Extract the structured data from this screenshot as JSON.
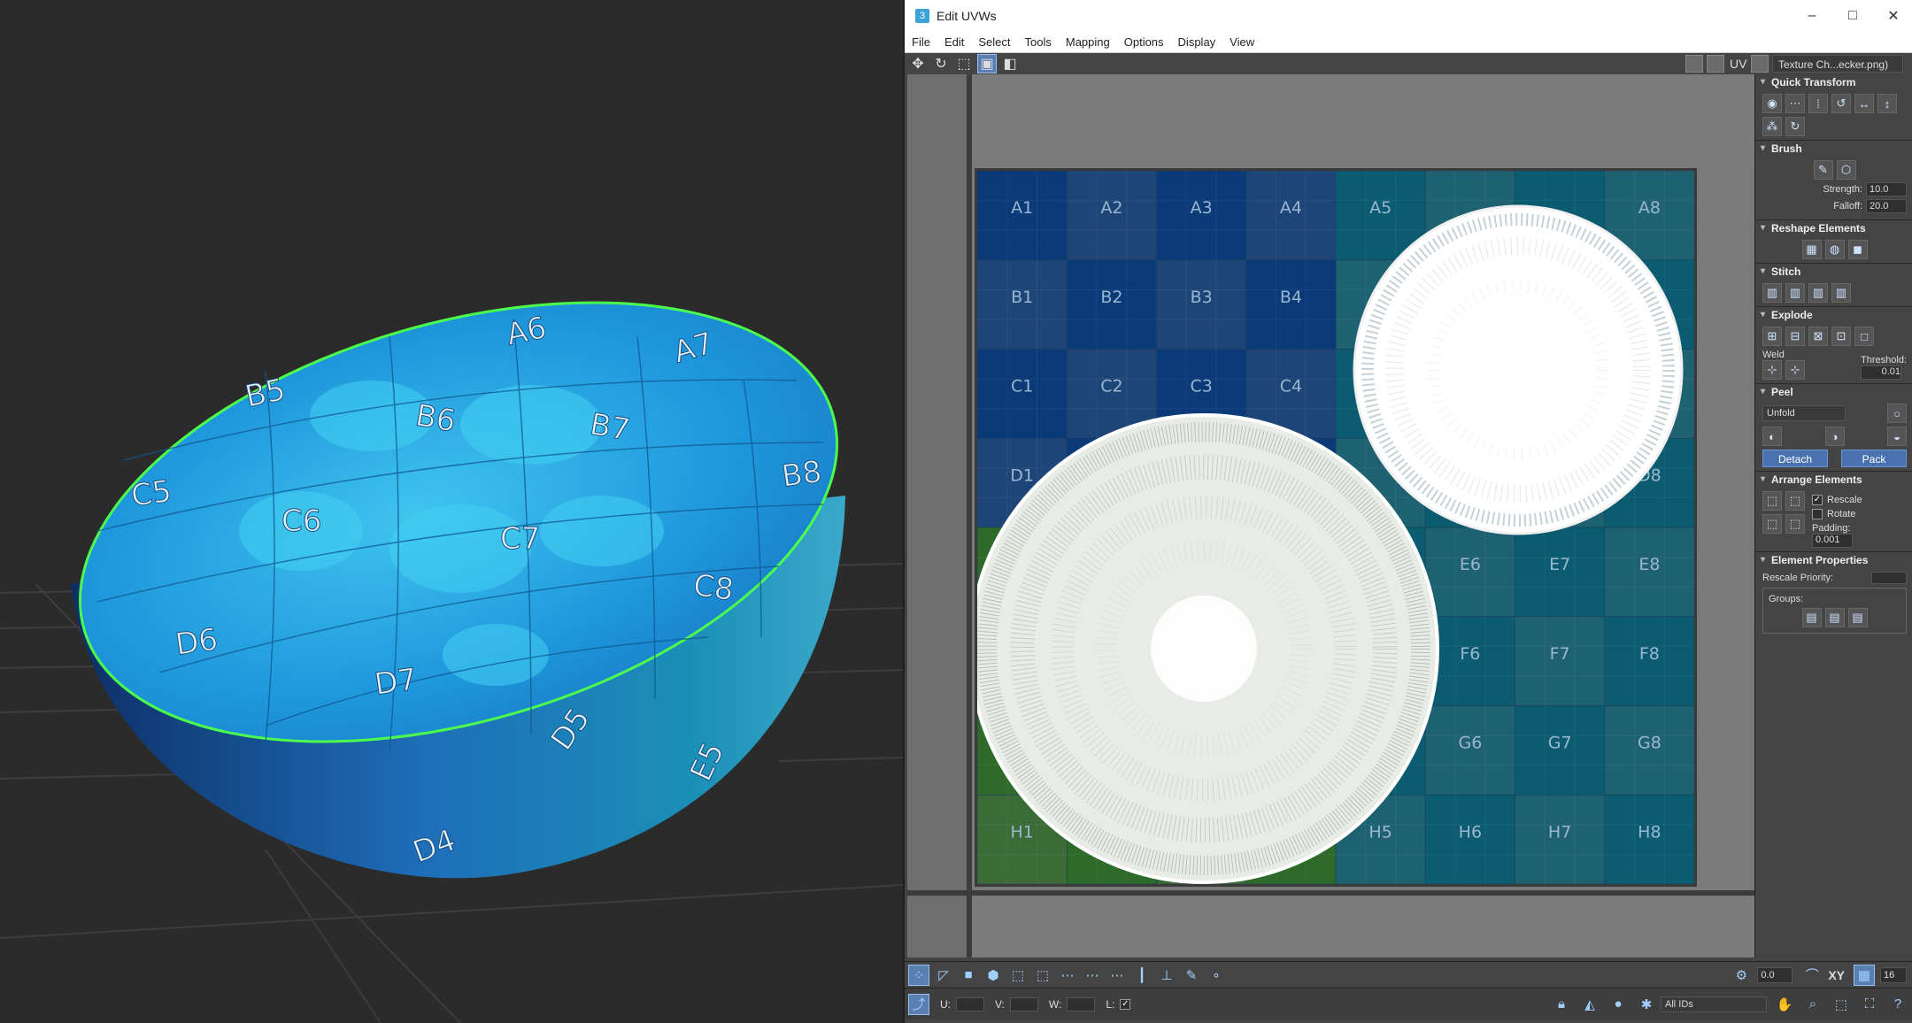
{
  "viewport": {
    "labels": [
      "A6",
      "A7",
      "B5",
      "B6",
      "B7",
      "B8",
      "C5",
      "C6",
      "C7",
      "C8",
      "D6",
      "D7",
      "D5",
      "E5",
      "D4"
    ]
  },
  "window": {
    "title": "Edit UVWs",
    "controls": [
      "–",
      "□",
      "✕"
    ]
  },
  "menu": [
    "File",
    "Edit",
    "Select",
    "Tools",
    "Mapping",
    "Options",
    "Display",
    "View"
  ],
  "toolbar": {
    "uv_label": "UV",
    "texture": "Texture Ch...ecker.png)"
  },
  "checker": {
    "rows": [
      "A",
      "B",
      "C",
      "D",
      "E",
      "F",
      "G",
      "H"
    ],
    "cols": [
      "1",
      "2",
      "3",
      "4",
      "5",
      "6",
      "7",
      "8"
    ],
    "visible_labels": [
      "A1",
      "A2",
      "A3",
      "A4",
      "A5",
      "A8",
      "B1",
      "B2",
      "B3",
      "B4",
      "C1",
      "C2",
      "C3",
      "C4",
      "D1",
      "D8",
      "E6",
      "E7",
      "E8",
      "F6",
      "F7",
      "F8",
      "G6",
      "G7",
      "G8",
      "H1",
      "H5",
      "H6",
      "H7",
      "H8"
    ],
    "colors": {
      "navy": "#0a3a78",
      "teal": "#0b5c70",
      "green": "#2e6a2a",
      "island_fill": "#ffffff"
    }
  },
  "panel": {
    "quick_transform": "Quick Transform",
    "brush": "Brush",
    "strength_label": "Strength:",
    "strength_value": "10.0",
    "falloff_label": "Falloff:",
    "falloff_value": "20.0",
    "reshape": "Reshape Elements",
    "stitch": "Stitch",
    "explode": "Explode",
    "weld": "Weld",
    "threshold_label": "Threshold:",
    "threshold_value": "0.01",
    "peel": "Peel",
    "peel_mode": "Unfold",
    "detach": "Detach",
    "pack": "Pack",
    "arrange": "Arrange Elements",
    "rescale": "Rescale",
    "rotate": "Rotate",
    "padding_label": "Padding:",
    "padding_value": "0.001",
    "element_props": "Element Properties",
    "rescale_priority": "Rescale Priority:",
    "groups": "Groups:"
  },
  "bottom": {
    "angle_value": "0.0",
    "xy_label": "XY",
    "grid_value": "16",
    "u_label": "U:",
    "v_label": "V:",
    "w_label": "W:",
    "l_label": "L:",
    "ids_value": "All IDs"
  }
}
